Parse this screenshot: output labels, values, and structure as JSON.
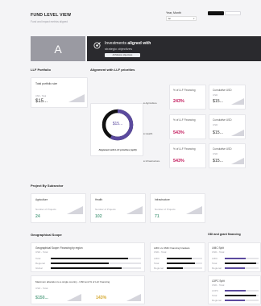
{
  "header": {
    "title": "FUND LEVEL VIEW",
    "subtitle": "Fund and impact metrics aligned",
    "year_month_label": "Year, Month",
    "year_month_value": "All",
    "toggle_left": "",
    "toggle_right": ""
  },
  "hero": {
    "avatar_letter": "A",
    "statement_prefix": "Investments",
    "statement_bold": "aligned with",
    "statement_line2": "strategic objectives",
    "button_label": "All Mission objectives"
  },
  "llf_portfolio": {
    "section_title": "LLF Portfolio",
    "card_title": "Total portfolio size",
    "card_sub": "USD - Total",
    "value": "$15..."
  },
  "alignment": {
    "section_title": "Alignment with LLF priorities",
    "donut_value": "$15...",
    "donut_caption": "Alignment with LLF priorities (split)",
    "donut_share": 0.58,
    "colors": {
      "primary": "#5b4a9e",
      "secondary": "#111111"
    },
    "rows": [
      {
        "name": "Agriculture",
        "pct_label": "% of LLF Financing",
        "pct_value": "243%",
        "usd_label": "Cumulative USD",
        "usd_value": "$15..."
      },
      {
        "name": "Health",
        "pct_label": "% of LLF Financing",
        "pct_value": "543%",
        "usd_label": "Cumulative USD",
        "usd_value": "$15..."
      },
      {
        "name": "Infrastructure",
        "pct_label": "% of LLF Financing",
        "pct_value": "543%",
        "usd_label": "Cumulative USD",
        "usd_value": "$15..."
      }
    ]
  },
  "subsector": {
    "section_title": "Project By Subsector",
    "cards": [
      {
        "title": "Agriculture",
        "sub": "Number of Projects",
        "value": "24"
      },
      {
        "title": "Health",
        "sub": "Number of Projects",
        "value": "102"
      },
      {
        "title": "Infrastructure",
        "sub": "Number of Projects",
        "value": "71"
      }
    ]
  },
  "geo": {
    "section_title": "Geographical Scope",
    "regions_title": "Geographical Scope: Financing by region",
    "regions_sub": "USD - Total",
    "regions": [
      {
        "label": "Total",
        "share": 0.86
      },
      {
        "label": "Regional",
        "share": 0.64
      },
      {
        "label": "Global",
        "share": 0.79
      }
    ],
    "brackets_title": "LMIC vs UMIC financing brackets",
    "brackets_sub": "USD - Total",
    "brackets": [
      {
        "label": "LMIC",
        "share": 0.7
      },
      {
        "label": "Total",
        "share": 0.8
      },
      {
        "label": "Regional",
        "share": 0.46
      }
    ],
    "max_title": "Maximum allocation to a single country - USD and % of LLF financing",
    "max_sub": "USD - Total",
    "max_usd": "$150...",
    "max_pct": "143%"
  },
  "odi": {
    "section_title": "ODI and grant financing",
    "card1_title": "LMIC Split",
    "card1_sub": "USD - Total",
    "card1_bars": [
      {
        "label": "LMIC",
        "share": 0.62
      },
      {
        "label": "Total",
        "share": 0.94
      },
      {
        "label": "Regional",
        "share": 0.6
      }
    ],
    "card2_title": "LDPC Split",
    "card2_sub": "USD - Total",
    "card2_bars": [
      {
        "label": "LDPC",
        "share": 0.62
      },
      {
        "label": "Total",
        "share": 0.94
      },
      {
        "label": "Regional",
        "share": 0.6
      }
    ]
  }
}
